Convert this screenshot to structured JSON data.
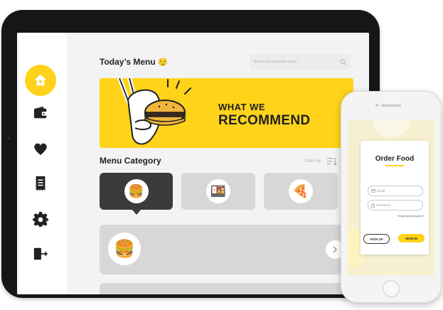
{
  "tablet": {
    "header": {
      "title": "Today’s Menu",
      "search_placeholder": "Search by restaurant name..."
    },
    "sidebar": {
      "items": [
        "home-icon",
        "wallet-icon",
        "heart-icon",
        "receipt-icon",
        "gear-icon",
        "logout-icon"
      ]
    },
    "banner": {
      "line1": "WHAT WE",
      "line2": "RECOMMEND"
    },
    "category": {
      "title": "Menu Category",
      "order_label": "Order By",
      "items": [
        "🍔",
        "🍱",
        "🍕"
      ]
    },
    "featured": {
      "emoji": "🍔"
    },
    "colors": {
      "accent": "#ffd31a",
      "dark": "#3b3b3b"
    }
  },
  "phone": {
    "title": "Order Food",
    "email_placeholder": "Email",
    "password_placeholder": "Password",
    "forgot": "Forgot your password?",
    "signup": "SIGN UP",
    "signin": "SIGN IN"
  }
}
